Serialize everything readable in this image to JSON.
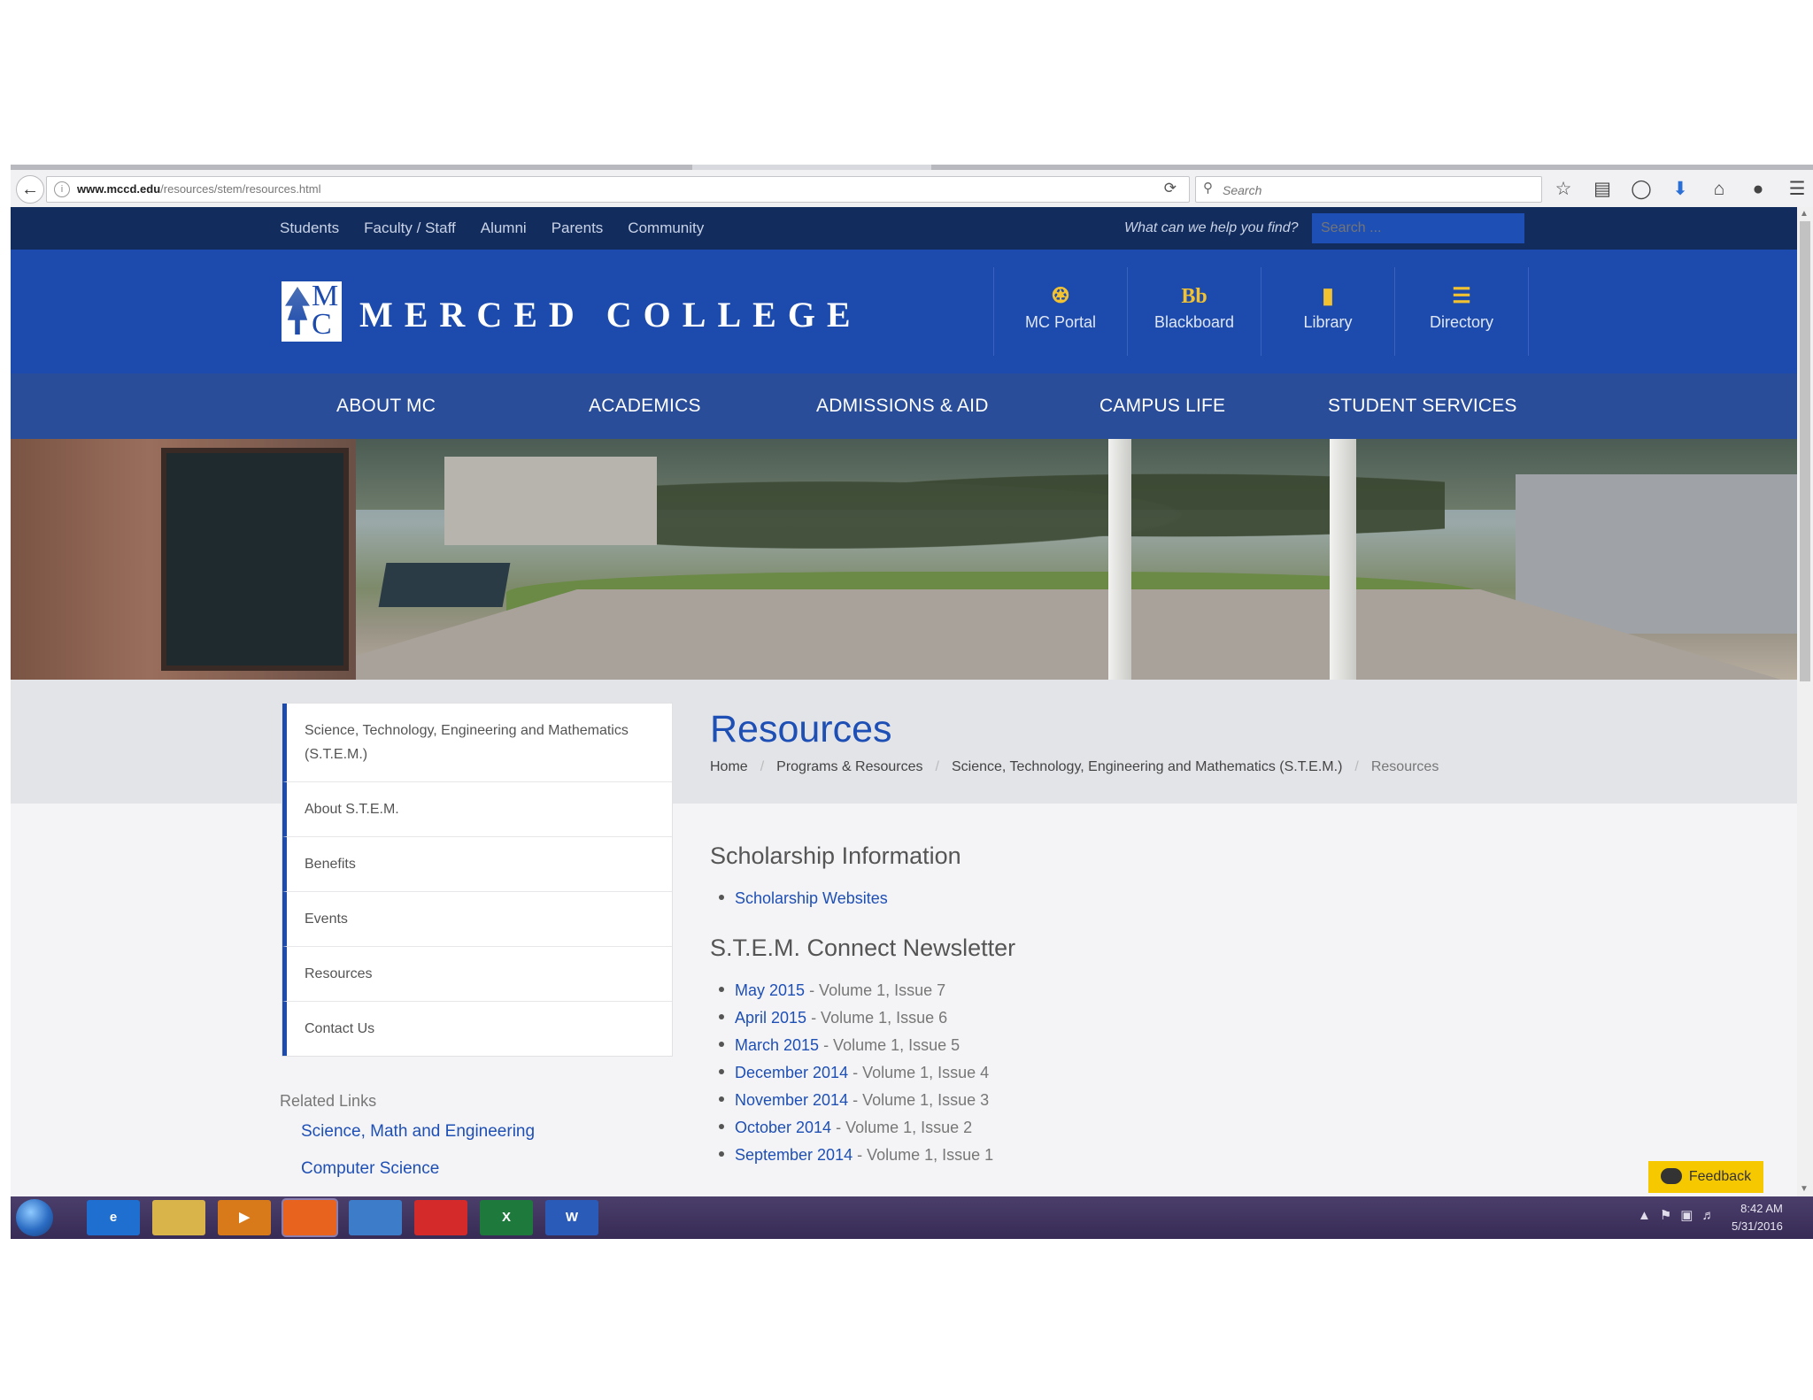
{
  "browser": {
    "url_host": "www.mccd.edu",
    "url_path": "/resources/stem/resources.html",
    "search_placeholder": "Search"
  },
  "utility_nav": {
    "links": [
      "Students",
      "Faculty / Staff",
      "Alumni",
      "Parents",
      "Community"
    ],
    "search_prompt": "What can we help you find?",
    "search_placeholder": "Search ..."
  },
  "brand": {
    "logo_letters": [
      "M",
      "C"
    ],
    "name": "MERCED COLLEGE"
  },
  "quick_links": [
    {
      "icon": "bank-icon",
      "glyph": "🏛",
      "label": "MC Portal"
    },
    {
      "icon": "blackboard-icon",
      "glyph": "Bb",
      "label": "Blackboard"
    },
    {
      "icon": "book-icon",
      "glyph": "📘",
      "label": "Library"
    },
    {
      "icon": "list-icon",
      "glyph": "☰",
      "label": "Directory"
    }
  ],
  "main_nav": [
    "ABOUT MC",
    "ACADEMICS",
    "ADMISSIONS & AID",
    "CAMPUS LIFE",
    "STUDENT SERVICES"
  ],
  "sidebar": {
    "items": [
      "Science, Technology, Engineering and Mathematics (S.T.E.M.)",
      "About S.T.E.M.",
      "Benefits",
      "Events",
      "Resources",
      "Contact Us"
    ],
    "related_heading": "Related Links",
    "related_links": [
      "Science, Math and Engineering",
      "Computer Science"
    ]
  },
  "page": {
    "title": "Resources",
    "breadcrumb": [
      "Home",
      "Programs & Resources",
      "Science, Technology, Engineering and Mathematics (S.T.E.M.)",
      "Resources"
    ],
    "scholarship_heading": "Scholarship Information",
    "scholarship_links": [
      "Scholarship Websites"
    ],
    "newsletter_heading": "S.T.E.M. Connect Newsletter",
    "newsletters": [
      {
        "link": "May 2015",
        "detail": " - Volume 1, Issue 7"
      },
      {
        "link": "April 2015",
        "detail": " - Volume 1, Issue 6"
      },
      {
        "link": "March 2015",
        "detail": " - Volume 1, Issue 5"
      },
      {
        "link": "December 2014",
        "detail": " - Volume 1, Issue 4"
      },
      {
        "link": "November 2014",
        "detail": " - Volume 1, Issue 3"
      },
      {
        "link": "October 2014",
        "detail": " - Volume 1, Issue 2"
      },
      {
        "link": "September 2014",
        "detail": " - Volume 1, Issue 1"
      }
    ]
  },
  "feedback_label": "Feedback",
  "taskbar": {
    "apps": [
      {
        "name": "ie-icon",
        "glyph": "e",
        "color": "#1f6fd1"
      },
      {
        "name": "folder-icon",
        "glyph": "",
        "color": "#d9b44a"
      },
      {
        "name": "media-player-icon",
        "glyph": "▶",
        "color": "#d87a1a"
      },
      {
        "name": "firefox-icon",
        "glyph": "",
        "color": "#e8641e"
      },
      {
        "name": "network-app-icon",
        "glyph": "",
        "color": "#3d7cc9"
      },
      {
        "name": "pdf-icon",
        "glyph": "",
        "color": "#d42a2a"
      },
      {
        "name": "excel-icon",
        "glyph": "X",
        "color": "#1e7a3c"
      },
      {
        "name": "word-icon",
        "glyph": "W",
        "color": "#2b5bb8"
      }
    ],
    "time": "8:42 AM",
    "date": "5/31/2016"
  },
  "colors": {
    "utility_bar": "#132c5e",
    "brand_bar": "#1d4bad",
    "link": "#1e4fb5",
    "accent_gold": "#f3c230",
    "feedback": "#f5c800"
  }
}
